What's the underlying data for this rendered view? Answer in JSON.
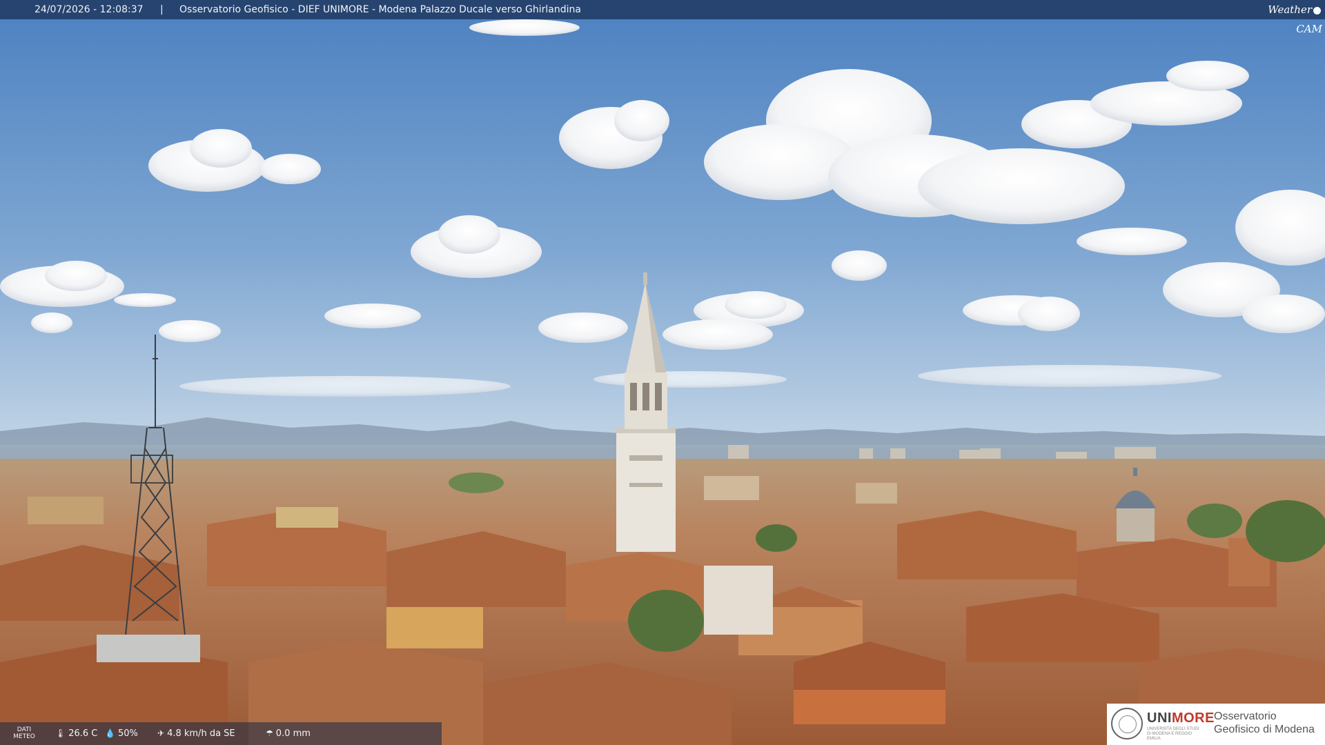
{
  "overlay": {
    "timestamp": "24/07/2026 - 12:08:37",
    "separator": "|",
    "title": "Osservatorio Geofisico - DIEF UNIMORE - Modena Palazzo Ducale verso Ghirlandina",
    "brand_left": "Weather",
    "brand_right": "CAM"
  },
  "weather": {
    "label": "DATI METEO",
    "temperature": "26.6 C",
    "humidity": "50%",
    "wind": "4.8 km/h da SE",
    "rain": "0.0 mm",
    "icons": [
      "thermometer-icon",
      "droplet-icon",
      "wind-icon",
      "rain-icon"
    ]
  },
  "logo": {
    "uni": "UNI",
    "more": "MORE",
    "sub": "UNIVERSITÀ DEGLI STUDI DI MODENA E REGGIO EMILIA",
    "observatory": "Osservatorio Geofisico di Modena"
  },
  "colors": {
    "sky_top": "#4d83c2",
    "sky_bottom": "#b7cde3",
    "roof": "#b5714a",
    "tower": "#e8e4dc",
    "accent": "#c0392b"
  }
}
